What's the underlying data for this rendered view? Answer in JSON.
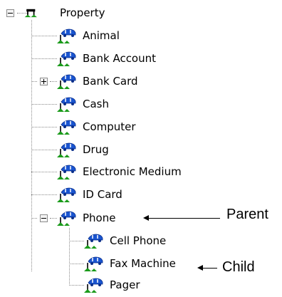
{
  "tree": {
    "root": {
      "label": "Property",
      "expanded": true
    },
    "children": [
      {
        "label": "Animal"
      },
      {
        "label": "Bank Account"
      },
      {
        "label": "Bank Card",
        "expanded": false
      },
      {
        "label": "Cash"
      },
      {
        "label": "Computer"
      },
      {
        "label": "Drug"
      },
      {
        "label": "Electronic Medium"
      },
      {
        "label": "ID Card"
      },
      {
        "label": "Phone",
        "expanded": true,
        "children": [
          {
            "label": "Cell Phone"
          },
          {
            "label": "Fax Machine"
          },
          {
            "label": "Pager"
          }
        ]
      }
    ]
  },
  "annotations": {
    "parent_label": "Parent",
    "child_label": "Child"
  },
  "icons": {
    "root": "root-node-icon",
    "node": "car-link-icon",
    "node_color": "#1a55d0",
    "node_base_color": "#1a9a1a"
  }
}
